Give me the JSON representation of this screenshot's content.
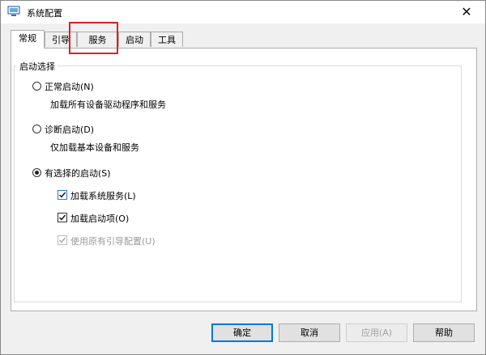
{
  "window": {
    "title": "系统配置",
    "close_glyph": "✕"
  },
  "tabs": [
    {
      "label": "常规",
      "active": true
    },
    {
      "label": "引导",
      "active": false
    },
    {
      "label": "服务",
      "active": false
    },
    {
      "label": "启动",
      "active": false
    },
    {
      "label": "工具",
      "active": false
    }
  ],
  "startup": {
    "group_title": "启动选择",
    "normal": {
      "label": "正常启动(N)",
      "description": "加载所有设备驱动程序和服务",
      "selected": false
    },
    "diagnostic": {
      "label": "诊断启动(D)",
      "description": "仅加载基本设备和服务",
      "selected": false
    },
    "selective": {
      "label": "有选择的启动(S)",
      "selected": true,
      "options": [
        {
          "label": "加载系统服务(L)",
          "checked": true,
          "enabled": true
        },
        {
          "label": "加载启动项(O)",
          "checked": true,
          "enabled": true
        },
        {
          "label": "使用原有引导配置(U)",
          "checked": true,
          "enabled": false
        }
      ]
    }
  },
  "buttons": {
    "ok": "确定",
    "cancel": "取消",
    "apply": "应用(A)",
    "help": "帮助"
  },
  "colors": {
    "highlight": "#e02020",
    "accent": "#0078d7"
  }
}
